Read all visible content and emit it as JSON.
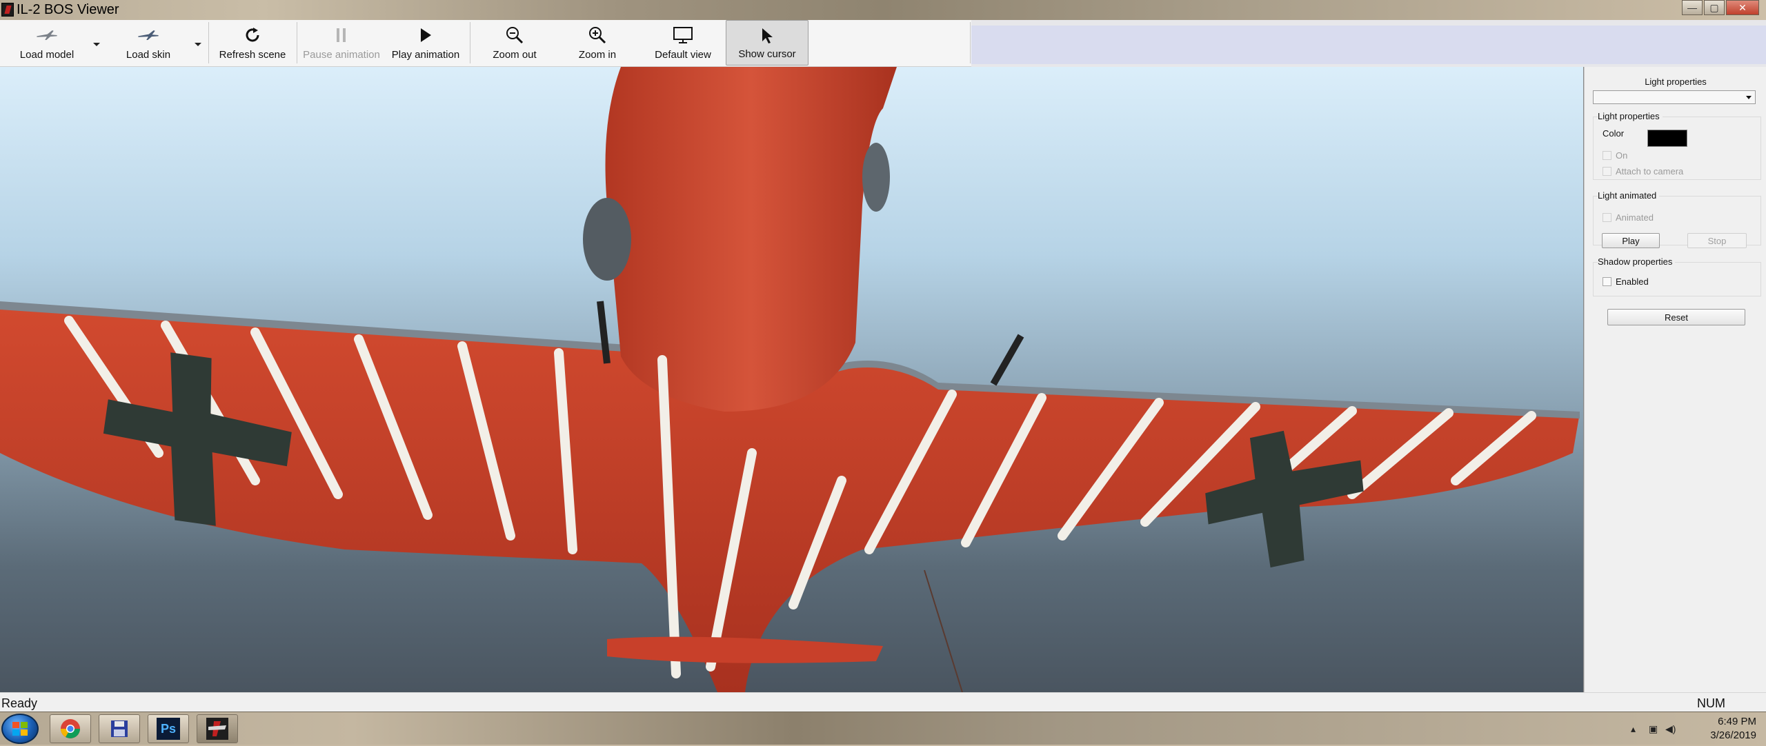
{
  "window": {
    "title": "IL-2 BOS Viewer",
    "controls": {
      "minimize": "—",
      "maximize": "▢",
      "close": "✕"
    }
  },
  "toolbar": {
    "load_model": "Load model",
    "load_skin": "Load skin",
    "refresh_scene": "Refresh scene",
    "pause_animation": "Pause animation",
    "play_animation": "Play animation",
    "zoom_out": "Zoom out",
    "zoom_in": "Zoom in",
    "default_view": "Default view",
    "show_cursor": "Show cursor"
  },
  "panel": {
    "title": "Light properties",
    "selector_value": "",
    "light_properties": {
      "label": "Light properties",
      "color_label": "Color",
      "color_value": "#000000",
      "on_label": "On",
      "attach_label": "Attach to camera"
    },
    "light_animated": {
      "label": "Light animated",
      "animated_label": "Animated",
      "play_label": "Play",
      "stop_label": "Stop"
    },
    "shadow": {
      "label": "Shadow properties",
      "enabled_label": "Enabled"
    },
    "reset_label": "Reset"
  },
  "status": {
    "left": "Ready",
    "right": "NUM"
  },
  "taskbar": {
    "apps": [
      "chrome-icon",
      "save-disk-icon",
      "Ps",
      "il2-viewer-icon"
    ],
    "time": "6:49 PM",
    "date": "3/26/2019"
  },
  "scene": {
    "description_colors": {
      "paint": "#c8402a",
      "stripe": "#f2efe8",
      "cross": "#2f3a35"
    }
  }
}
